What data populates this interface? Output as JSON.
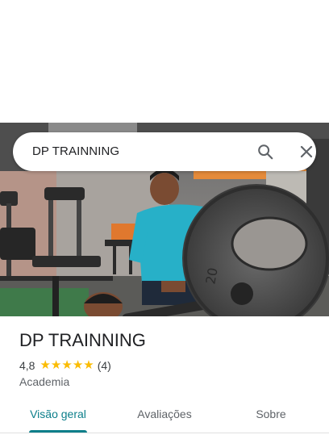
{
  "search": {
    "query": "DP TRAINNING",
    "search_icon": "search-icon",
    "close_icon": "close-icon"
  },
  "place": {
    "name": "DP TRAINNING",
    "rating": "4,8",
    "stars": 5,
    "review_count": "(4)",
    "category": "Academia"
  },
  "tabs": [
    {
      "label": "Visão geral",
      "active": true
    },
    {
      "label": "Avaliações",
      "active": false
    },
    {
      "label": "Sobre",
      "active": false
    }
  ],
  "colors": {
    "accent": "#0b7e8a",
    "star": "#fbbc04",
    "title": "#202124"
  }
}
